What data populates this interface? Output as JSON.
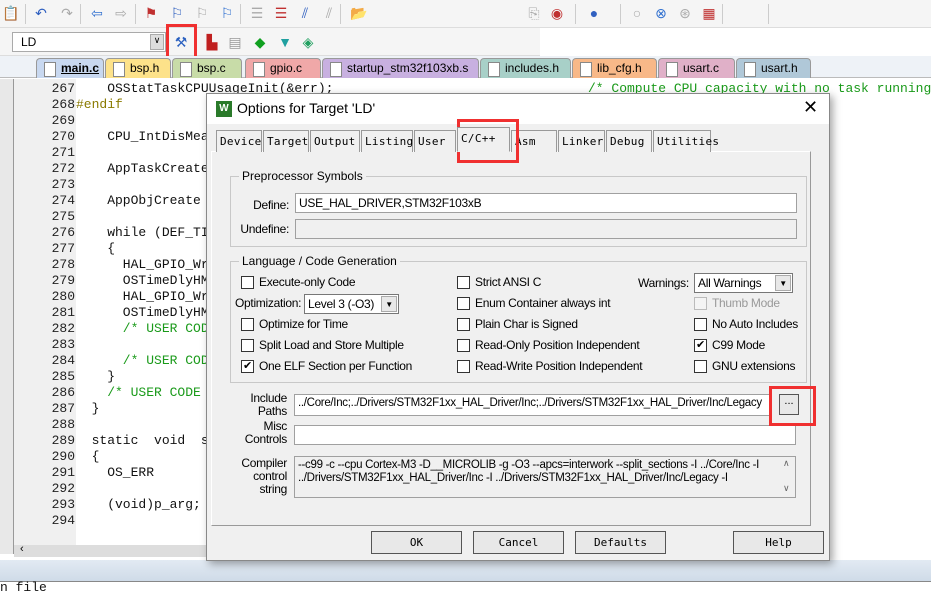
{
  "toolbar": {
    "target_select": "LD",
    "icons_row1": [
      "paste-icon",
      "undo-icon",
      "redo-icon",
      "back-icon",
      "forward-icon",
      "bookmark-icon",
      "prev-bookmark-icon",
      "next-bookmark-icon",
      "clear-bookmarks-icon",
      "indent-icon",
      "unindent-icon",
      "comment-icon",
      "uncomment-icon",
      "find-in-files-icon",
      "find-icon",
      "debug-icon",
      "breakpoint-icon",
      "disable-breakpoint-icon",
      "kill-breakpoints-icon",
      "window-icon",
      "settings-icon"
    ],
    "icons_row2": [
      "options-for-target-icon",
      "manage-components-icon",
      "select-packs-icon",
      "pack-installer-icon",
      "translate-icon",
      "batch-build-icon"
    ]
  },
  "file_tabs": [
    {
      "label": "main.c",
      "color": "#c8d8f0"
    },
    {
      "label": "bsp.h",
      "color": "#fde28a"
    },
    {
      "label": "bsp.c",
      "color": "#c8dca8"
    },
    {
      "label": "gpio.c",
      "color": "#f0a8a8"
    },
    {
      "label": "startup_stm32f103xb.s",
      "color": "#c8b0e0"
    },
    {
      "label": "includes.h",
      "color": "#a8d0c8"
    },
    {
      "label": "lib_cfg.h",
      "color": "#f8b888"
    },
    {
      "label": "usart.c",
      "color": "#e0b0c8"
    },
    {
      "label": "usart.h",
      "color": "#b0c8d8"
    }
  ],
  "editor": {
    "line_numbers": [
      "267",
      "268",
      "269",
      "270",
      "271",
      "272",
      "273",
      "274",
      "275",
      "276",
      "277",
      "278",
      "279",
      "280",
      "281",
      "282",
      "283",
      "284",
      "285",
      "286",
      "287",
      "288",
      "289",
      "290",
      "291",
      "292",
      "293",
      "294"
    ],
    "lines": [
      "    OSStatTaskCPUUsageInit(&err);",
      "#endif",
      "",
      "    CPU_IntDisMea",
      "",
      "    AppTaskCreate",
      "",
      "    AppObjCreate",
      "",
      "    while (DEF_TI",
      "    {",
      "      HAL_GPIO_Wr",
      "      OSTimeDlyHM",
      "      HAL_GPIO_Wr",
      "      OSTimeDlyHM",
      "      /* USER COD",
      "",
      "      /* USER COD",
      "    }",
      "    /* USER CODE",
      "  }",
      "",
      "  static  void  s",
      "  {",
      "    OS_ERR       e",
      "",
      "    (void)p_arg;",
      ""
    ],
    "right_comment": "/* Compute CPU capacity with no task running",
    "status_text": "n file"
  },
  "dialog": {
    "title": "Options for Target 'LD'",
    "tabs": [
      "Device",
      "Target",
      "Output",
      "Listing",
      "User",
      "C/C++",
      "Asm",
      "Linker",
      "Debug",
      "Utilities"
    ],
    "active_tab": "C/C++",
    "preprocessor": {
      "group": "Preprocessor Symbols",
      "define_label": "Define:",
      "define_value": "USE_HAL_DRIVER,STM32F103xB",
      "undefine_label": "Undefine:",
      "undefine_value": ""
    },
    "language": {
      "group": "Language / Code Generation",
      "checkboxes": [
        {
          "label": "Execute-only Code",
          "checked": false
        },
        {
          "label": "Optimize for Time",
          "checked": false
        },
        {
          "label": "Split Load and Store Multiple",
          "checked": false
        },
        {
          "label": "One ELF Section per Function",
          "checked": true
        },
        {
          "label": "Strict ANSI C",
          "checked": false
        },
        {
          "label": "Enum Container always int",
          "checked": false
        },
        {
          "label": "Plain Char is Signed",
          "checked": false
        },
        {
          "label": "Read-Only Position Independent",
          "checked": false
        },
        {
          "label": "Read-Write Position Independent",
          "checked": false
        },
        {
          "label": "Thumb Mode",
          "checked": false,
          "disabled": true
        },
        {
          "label": "No Auto Includes",
          "checked": false
        },
        {
          "label": "C99 Mode",
          "checked": true
        },
        {
          "label": "GNU extensions",
          "checked": false
        }
      ],
      "optimization_label": "Optimization:",
      "optimization_value": "Level 3 (-O3)",
      "warnings_label": "Warnings:",
      "warnings_value": "All Warnings"
    },
    "include_label": "Include Paths",
    "include_value": "../Core/Inc;../Drivers/STM32F1xx_HAL_Driver/Inc;../Drivers/STM32F1xx_HAL_Driver/Inc/Legacy",
    "browse_label": "...",
    "misc_label": "Misc Controls",
    "misc_value": "",
    "compiler_label": "Compiler control string",
    "compiler_value": "--c99 -c --cpu Cortex-M3 -D__MICROLIB -g -O3 --apcs=interwork --split_sections -I ../Core/Inc -I ../Drivers/STM32F1xx_HAL_Driver/Inc -I ../Drivers/STM32F1xx_HAL_Driver/Inc/Legacy -I",
    "buttons": {
      "ok": "OK",
      "cancel": "Cancel",
      "defaults": "Defaults",
      "help": "Help"
    }
  },
  "colors": {
    "highlight": "#f03030",
    "keyword": "#1a1aff",
    "comment": "#1a9a1a"
  }
}
